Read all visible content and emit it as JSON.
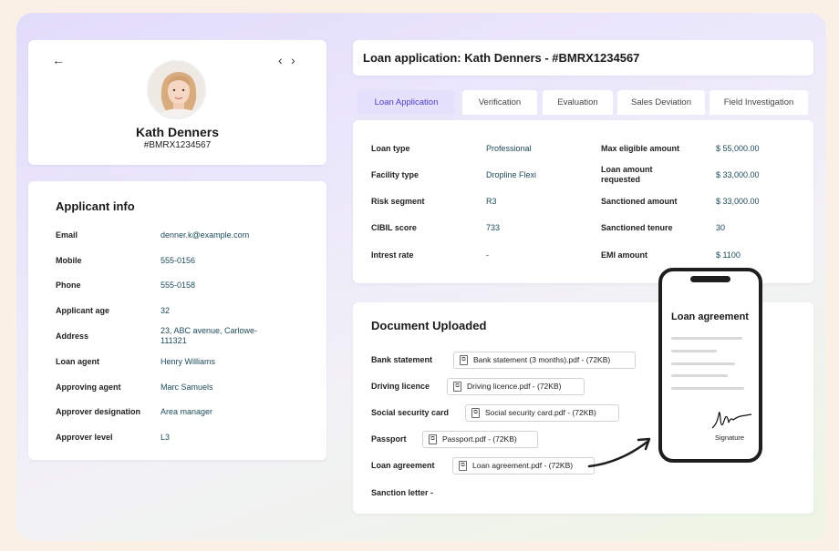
{
  "profile": {
    "name": "Kath Denners",
    "id": "#BMRX1234567",
    "back_icon": "arrow-left-icon",
    "prev_icon": "chevron-left-icon",
    "next_icon": "chevron-right-icon"
  },
  "applicant_info": {
    "title": "Applicant info",
    "rows": [
      {
        "label": "Email",
        "value": "denner.k@example.com"
      },
      {
        "label": "Mobile",
        "value": "555-0156"
      },
      {
        "label": "Phone",
        "value": "555-0158"
      },
      {
        "label": "Applicant age",
        "value": "32"
      },
      {
        "label": "Address",
        "value": "23, ABC avenue, Carlowe-111321"
      },
      {
        "label": "Loan agent",
        "value": "Henry Williams"
      },
      {
        "label": "Approving agent",
        "value": "Marc Samuels"
      },
      {
        "label": "Approver designation",
        "value": "Area manager"
      },
      {
        "label": "Approver level",
        "value": "L3"
      }
    ]
  },
  "header": {
    "title": "Loan application: Kath Denners - #BMRX1234567"
  },
  "tabs": [
    {
      "label": "Loan Application",
      "active": true
    },
    {
      "label": "Verification",
      "active": false
    },
    {
      "label": "Evaluation",
      "active": false
    },
    {
      "label": "Sales Deviation",
      "active": false
    },
    {
      "label": "Field Investigation",
      "active": false
    }
  ],
  "loan_details": {
    "left": [
      {
        "label": "Loan type",
        "value": "Professional"
      },
      {
        "label": "Facility type",
        "value": "Dropline Flexi"
      },
      {
        "label": "Risk segment",
        "value": "R3"
      },
      {
        "label": "CIBIL score",
        "value": "733"
      },
      {
        "label": "Intrest rate",
        "value": "-"
      }
    ],
    "right": [
      {
        "label": "Max eligible amount",
        "value": "$ 55,000.00"
      },
      {
        "label": "Loan amount requested",
        "value": "$ 33,000.00"
      },
      {
        "label": "Sanctioned amount",
        "value": "$ 33,000.00"
      },
      {
        "label": "Sanctioned tenure",
        "value": "30"
      },
      {
        "label": "EMI amount",
        "value": "$ 1100"
      }
    ]
  },
  "documents": {
    "title": "Document Uploaded",
    "items": [
      {
        "label": "Bank statement",
        "file": "Bank statement (3 months).pdf - (72KB)"
      },
      {
        "label": "Driving licence",
        "file": "Driving licence.pdf - (72KB)"
      },
      {
        "label": "Social security card",
        "file": "Social security card.pdf - (72KB)"
      },
      {
        "label": "Passport",
        "file": "Passport.pdf - (72KB)"
      },
      {
        "label": "Loan agreement",
        "file": "Loan agreement.pdf - (72KB)"
      },
      {
        "label": "Sanction letter -",
        "file": ""
      }
    ],
    "file_icon": "pdf-file-icon"
  },
  "phone": {
    "title": "Loan agreement",
    "signature_label": "Signature"
  }
}
